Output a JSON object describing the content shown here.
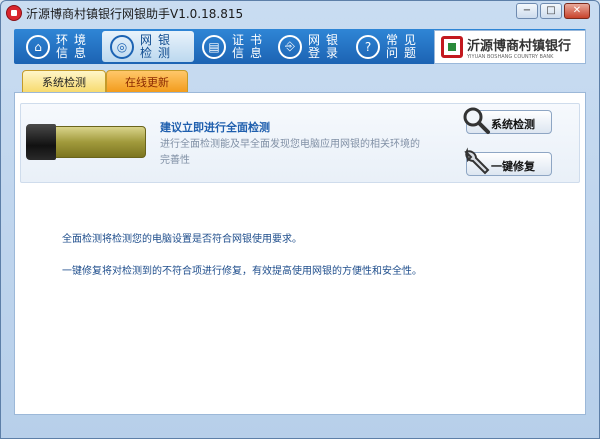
{
  "window": {
    "title": "沂源博商村镇银行网银助手V1.0.18.815",
    "controls": {
      "minimize": "−",
      "restore": "□",
      "close": "✕"
    }
  },
  "nav": {
    "items": [
      {
        "line1": "环境",
        "line2": "信息",
        "icon": "home-icon",
        "glyph": "⌂"
      },
      {
        "line1": "网银",
        "line2": "检测",
        "icon": "usb-key-icon",
        "glyph": "◎"
      },
      {
        "line1": "证书",
        "line2": "信息",
        "icon": "certificate-icon",
        "glyph": "▤"
      },
      {
        "line1": "网银",
        "line2": "登录",
        "icon": "login-icon",
        "glyph": "⎆"
      },
      {
        "line1": "常见",
        "line2": "问题",
        "icon": "question-icon",
        "glyph": "?"
      }
    ],
    "active_index": 1
  },
  "brand": {
    "name_cn": "沂源博商村镇银行",
    "name_en": "YIYUAN BOSHANG COUNTRY BANK"
  },
  "tabs": {
    "active": "系统检测",
    "inactive": "在线更新"
  },
  "panel": {
    "title": "建议立即进行全面检测",
    "desc": "进行全面检测能及早全面发现您电脑应用网银的相关环境的完善性",
    "check_button": "系统检测",
    "repair_button": "一键修复"
  },
  "info": {
    "line1": "全面检测将检测您的电脑设置是否符合网银使用要求。",
    "line2": "一键修复将对检测到的不符合项进行修复，有效提高使用网银的方便性和安全性。"
  },
  "colors": {
    "nav_bg": "#1c63b3",
    "accent_blue": "#1f5fae",
    "brand_red": "#c3191f",
    "tab_active": "#f7d96a",
    "tab_update": "#f29a19"
  }
}
